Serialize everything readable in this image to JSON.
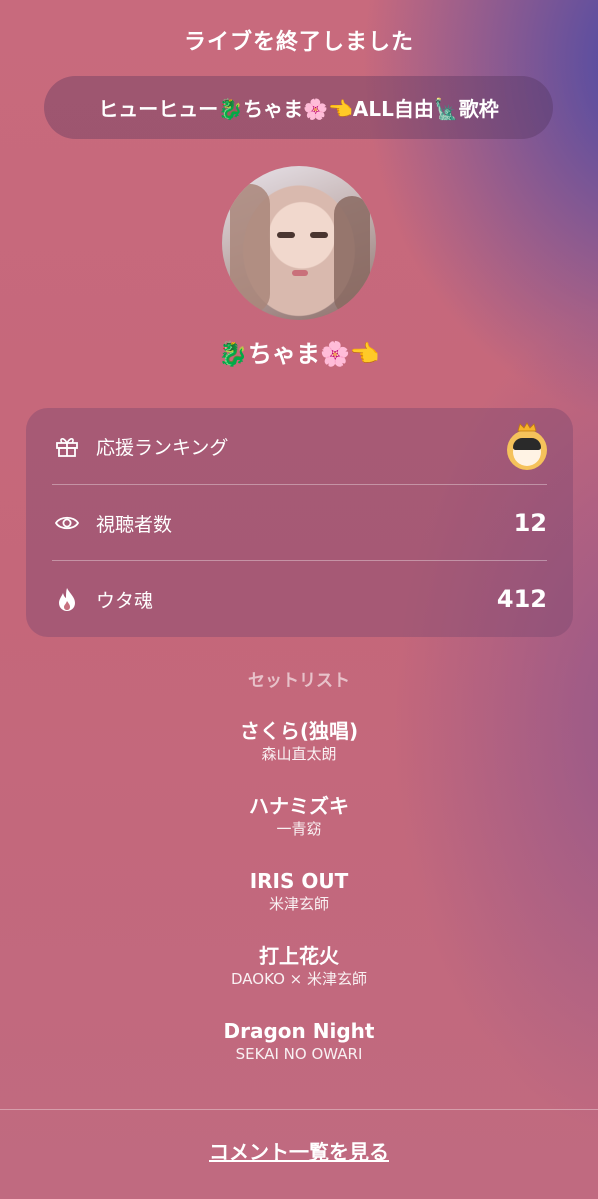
{
  "header": {
    "title": "ライブを終了しました"
  },
  "live": {
    "title": "ヒューヒュー🐉ちゃま🌸👈ALL自由🗽歌枠"
  },
  "streamer": {
    "name": "🐉ちゃま🌸👈"
  },
  "stats": {
    "ranking_label": "応援ランキング",
    "viewers_label": "視聴者数",
    "viewers_value": "12",
    "soul_label": "ウタ魂",
    "soul_value": "412"
  },
  "setlist": {
    "heading": "セットリスト",
    "songs": [
      {
        "title": "さくら(独唱)",
        "artist": "森山直太朗"
      },
      {
        "title": "ハナミズキ",
        "artist": "一青窈"
      },
      {
        "title": "IRIS OUT",
        "artist": "米津玄師"
      },
      {
        "title": "打上花火",
        "artist": "DAOKO × 米津玄師"
      },
      {
        "title": "Dragon Night",
        "artist": "SEKAI NO OWARI"
      }
    ]
  },
  "footer": {
    "comments_link": "コメント一覧を見る"
  },
  "icons": [
    "gift-icon",
    "eye-icon",
    "flame-icon",
    "crown-icon"
  ]
}
